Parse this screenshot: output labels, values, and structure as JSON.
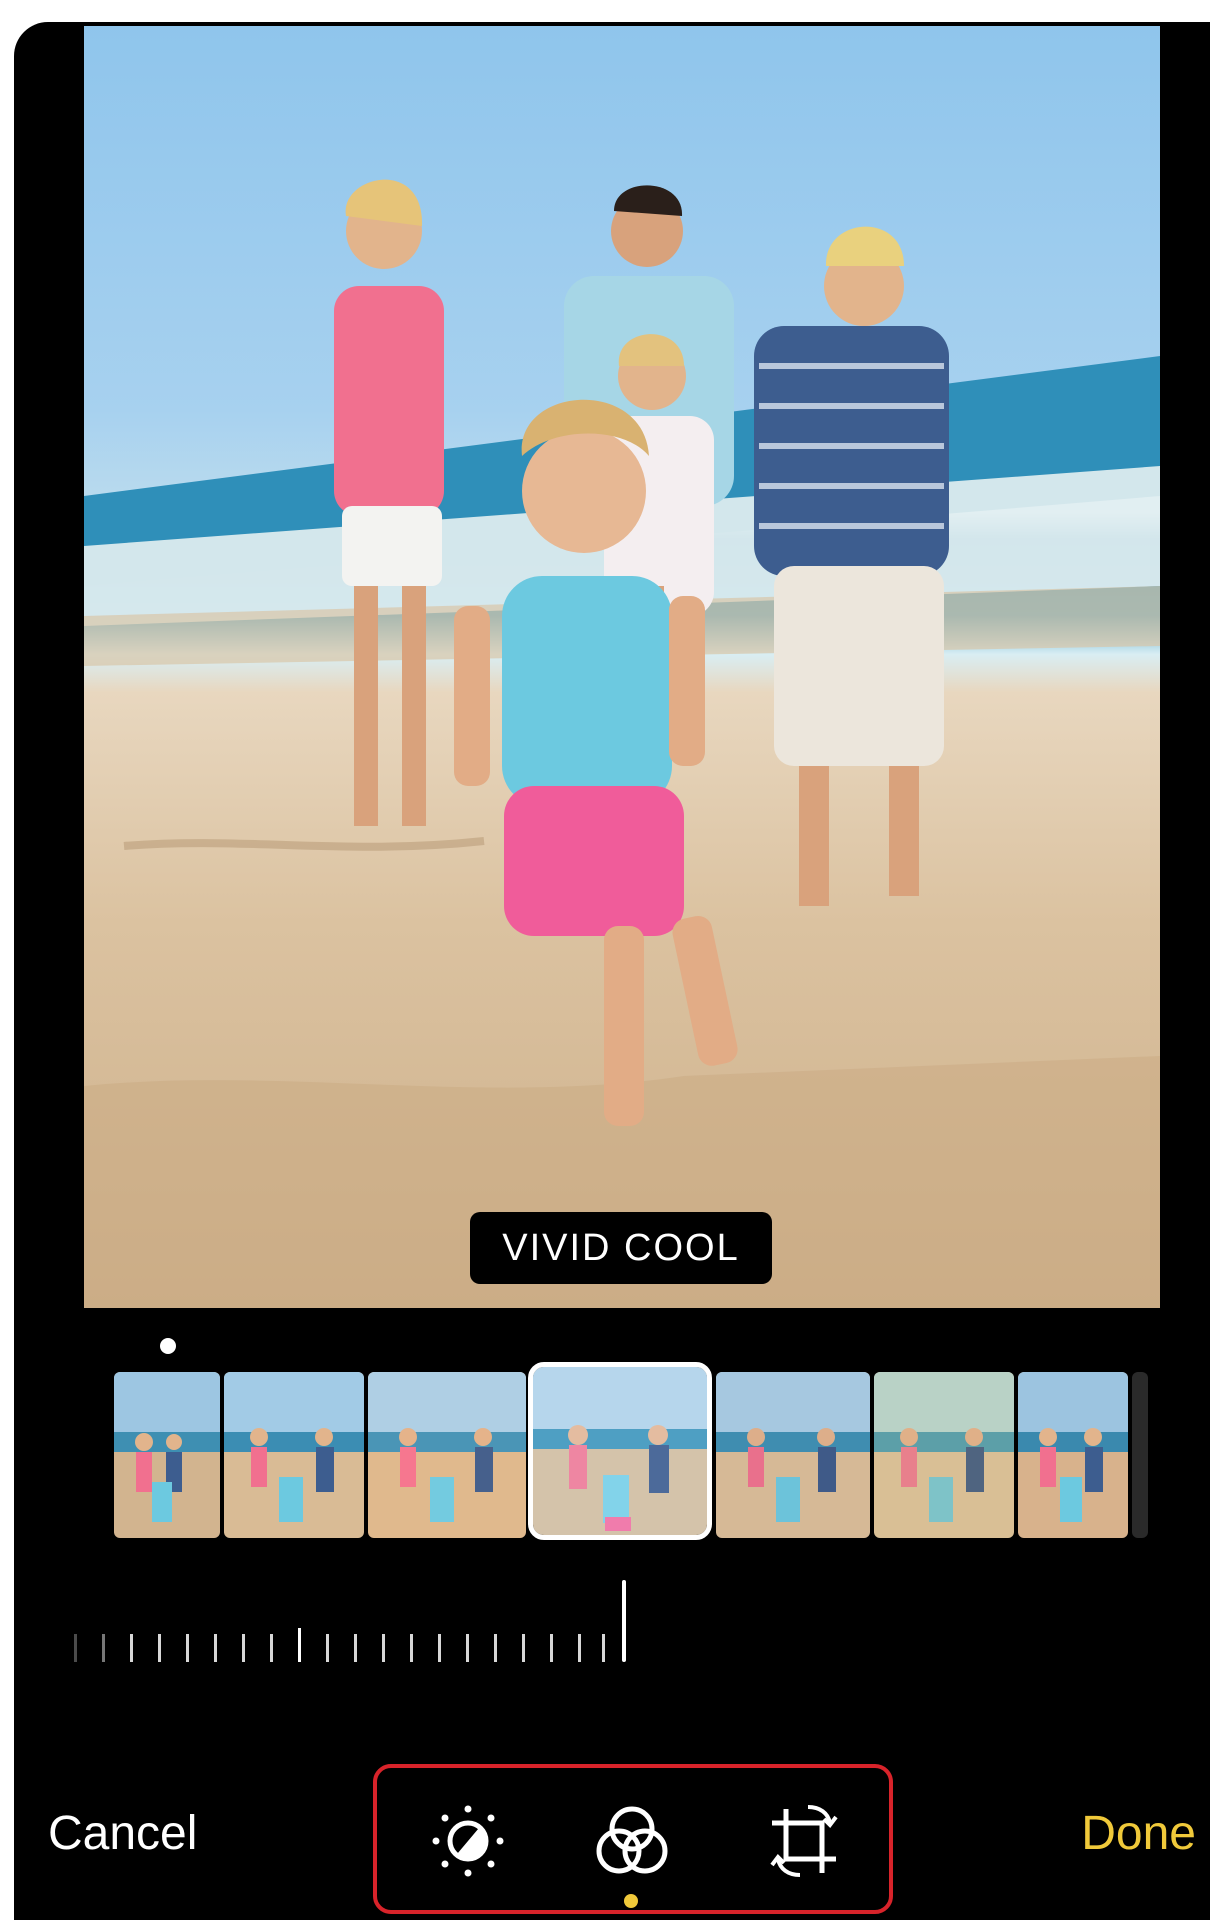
{
  "photo": {
    "filter_name": "VIVID COOL"
  },
  "filmstrip": {
    "selected_index": 3,
    "thumbnail_count": 8
  },
  "toolbar": {
    "cancel_label": "Cancel",
    "done_label": "Done",
    "tools": [
      {
        "icon": "adjust-icon"
      },
      {
        "icon": "filters-icon"
      },
      {
        "icon": "crop-rotate-icon"
      }
    ],
    "active_tool_index": 1,
    "colors": {
      "accent": "#f0c93a",
      "highlight_outline": "#d8232a",
      "background": "#000000"
    }
  }
}
